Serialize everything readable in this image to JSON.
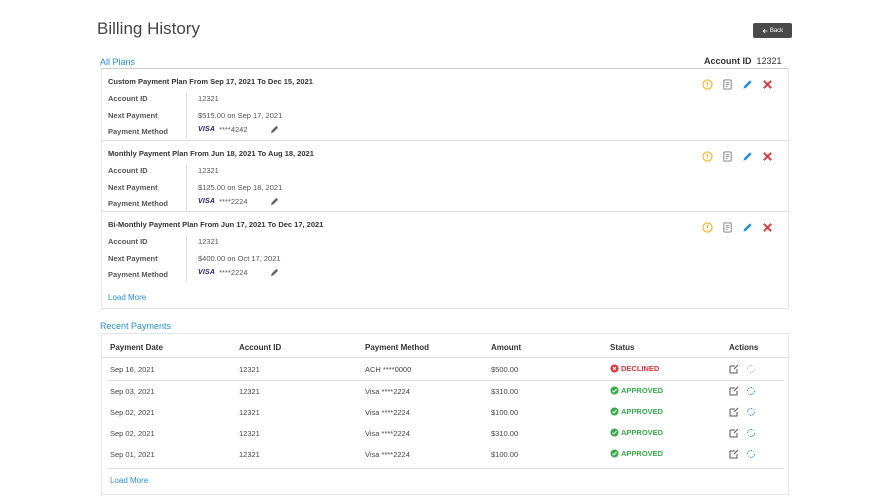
{
  "header": {
    "title": "Billing History",
    "back_label": "Back"
  },
  "plans_section": {
    "link": "All Plans",
    "account_label": "Account ID",
    "account_value": "12321",
    "labels": {
      "account": "Account ID",
      "next": "Next Payment",
      "method": "Payment Method"
    },
    "items": [
      {
        "title": "Custom Payment Plan From Sep 17, 2021 To Dec 15, 2021",
        "account": "12321",
        "next": "$515.00 on Sep 17, 2021",
        "card_brand": "VISA",
        "card": "****4242"
      },
      {
        "title": "Monthly Payment Plan From Jun 18, 2021 To Aug 18, 2021",
        "account": "12321",
        "next": "$125.00 on Sep 18, 2021",
        "card_brand": "VISA",
        "card": "****2224"
      },
      {
        "title": "Bi-Monthly Payment Plan From Jun 17, 2021 To Dec 17, 2021",
        "account": "12321",
        "next": "$400.00 on Oct 17, 2021",
        "card_brand": "VISA",
        "card": "****2224"
      }
    ],
    "load_more": "Load More"
  },
  "payments_section": {
    "link": "Recent Payments",
    "columns": [
      "Payment Date",
      "Account ID",
      "Payment Method",
      "Amount",
      "Status",
      "Actions"
    ],
    "rows": [
      {
        "date": "Sep 16, 2021",
        "account": "12321",
        "method": "ACH ****0000",
        "amount": "$500.00",
        "status": "DECLINED"
      },
      {
        "date": "Sep 03, 2021",
        "account": "12321",
        "method": "Visa ****2224",
        "amount": "$310.00",
        "status": "APPROVED"
      },
      {
        "date": "Sep 02, 2021",
        "account": "12321",
        "method": "Visa ****2224",
        "amount": "$100.00",
        "status": "APPROVED"
      },
      {
        "date": "Sep 02, 2021",
        "account": "12321",
        "method": "Visa ****2224",
        "amount": "$310.00",
        "status": "APPROVED"
      },
      {
        "date": "Sep 01, 2021",
        "account": "12321",
        "method": "Visa ****2224",
        "amount": "$100.00",
        "status": "APPROVED"
      }
    ],
    "load_more": "Load More"
  },
  "colors": {
    "accent": "#2a8fd6",
    "declined": "#d83a3a",
    "approved": "#3aab4c",
    "warning": "#f0b323",
    "delete": "#d83a3a"
  }
}
